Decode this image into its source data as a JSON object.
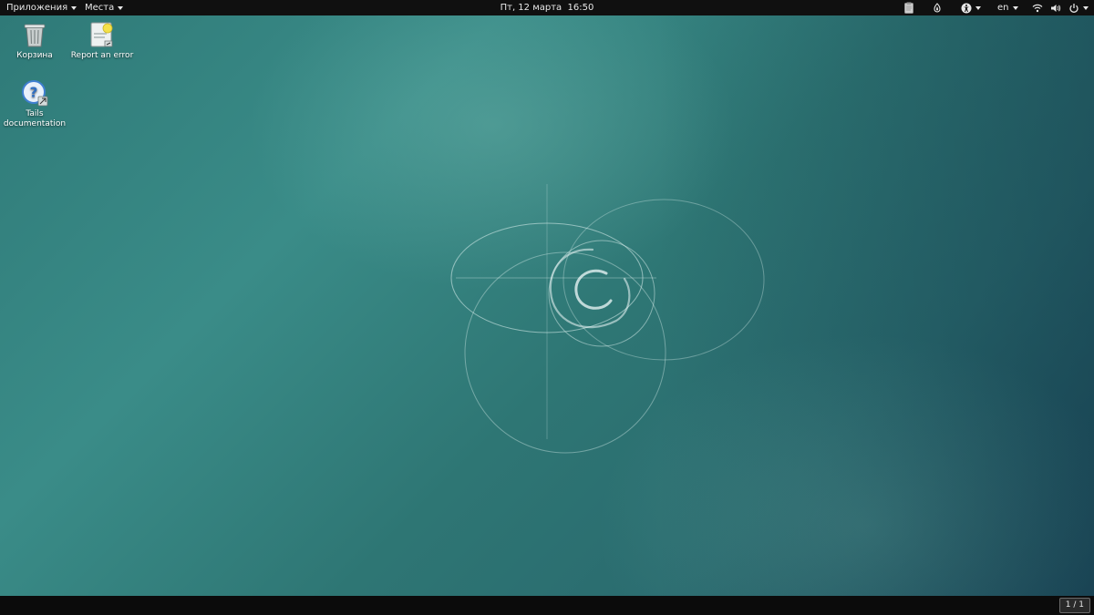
{
  "topbar": {
    "applications_label": "Приложения",
    "places_label": "Места",
    "clock": "Пт, 12 марта  16:50",
    "language": "en"
  },
  "desktop": {
    "icons": [
      {
        "label": "Корзина",
        "icon": "trash-icon"
      },
      {
        "label": "Report an error",
        "icon": "report-error-icon"
      },
      {
        "label": "Tails documentation",
        "icon": "help-doc-icon"
      }
    ]
  },
  "bottombar": {
    "workspace": "1 / 1"
  },
  "colors": {
    "bar": "#101010",
    "desktop_teal": "#3a8c88",
    "desktop_dark": "#1f4f5e"
  }
}
